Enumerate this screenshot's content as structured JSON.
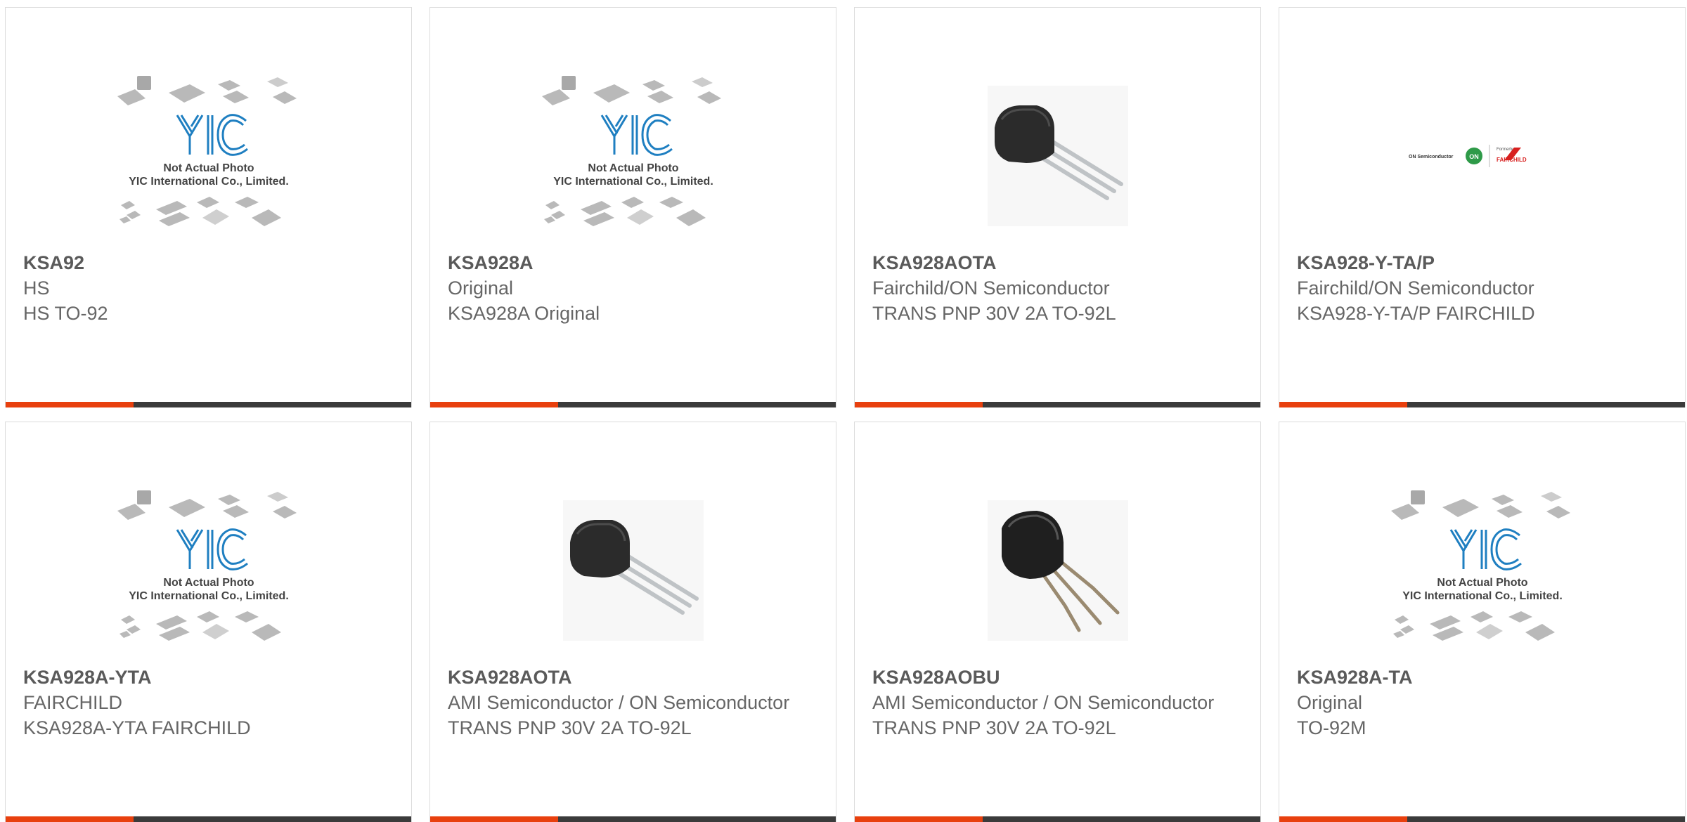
{
  "colors": {
    "accent": "#e8400e",
    "bar": "#3b3b3b",
    "text": "#666666",
    "yic_blue": "#1f7fc1"
  },
  "placeholder": {
    "line1": "Not Actual Photo",
    "line2": "YIC International Co., Limited.",
    "logo": "YIC"
  },
  "onsemi_logo": {
    "left": "ON Semiconductor",
    "on": "ON",
    "formerly": "Formerly",
    "fairchild": "FAIRCHILD"
  },
  "products": [
    {
      "part": "KSA92",
      "manufacturer": "HS",
      "description": "HS TO-92",
      "image": "yic-placeholder"
    },
    {
      "part": "KSA928A",
      "manufacturer": "Original",
      "description": "KSA928A Original",
      "image": "yic-placeholder"
    },
    {
      "part": "KSA928AOTA",
      "manufacturer": "Fairchild/ON Semiconductor",
      "description": "TRANS PNP 30V 2A TO-92L",
      "image": "to92-transistor"
    },
    {
      "part": "KSA928-Y-TA/P",
      "manufacturer": "Fairchild/ON Semiconductor",
      "description": "KSA928-Y-TA/P FAIRCHILD",
      "image": "onsemi-fairchild-logo"
    },
    {
      "part": "KSA928A-YTA",
      "manufacturer": "FAIRCHILD",
      "description": "KSA928A-YTA FAIRCHILD",
      "image": "yic-placeholder"
    },
    {
      "part": "KSA928AOTA",
      "manufacturer": "AMI Semiconductor / ON Semiconductor",
      "description": "TRANS PNP 30V 2A TO-92L",
      "image": "to92-transistor"
    },
    {
      "part": "KSA928AOBU",
      "manufacturer": "AMI Semiconductor / ON Semiconductor",
      "description": "TRANS PNP 30V 2A TO-92L",
      "image": "to92l-transistor-bent"
    },
    {
      "part": "KSA928A-TA",
      "manufacturer": "Original",
      "description": "TO-92M",
      "image": "yic-placeholder"
    }
  ]
}
